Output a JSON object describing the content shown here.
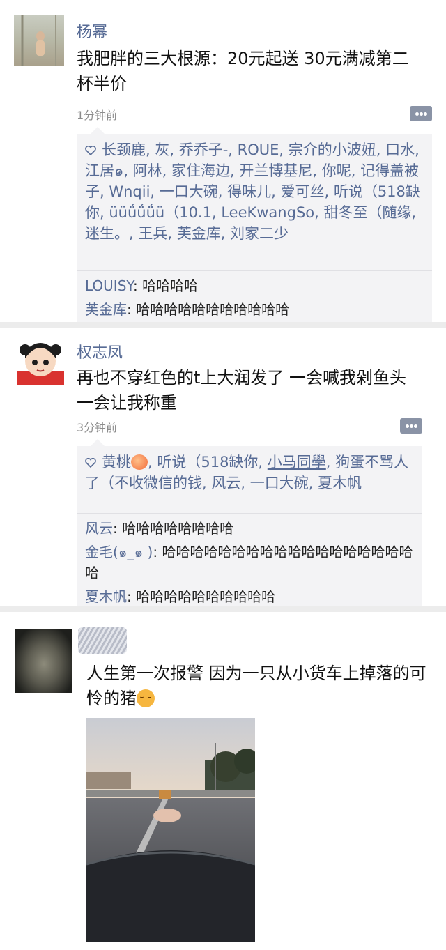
{
  "posts": [
    {
      "name": "杨幂",
      "content": "我肥胖的三大根源：20元起送 30元满减第二杯半价",
      "time": "1分钟前",
      "likes": "长颈鹿, 灰, 乔乔子-, ROUE, 宗介的小波妞, 口水, 江居๑, 阿林, 家住海边, 开兰博基尼, 你呢, 记得盖被子, Wnqii, 一口大碗, 得味儿, 爱可丝, 听说（518缺你, üüǘǘǘü（10.1, LeeKwangSo, 甜冬至（随缘, 迷生。, 王兵, 芙金库, 刘家二少",
      "comments": [
        {
          "who": "LOUISY",
          "sep": ": ",
          "text": "哈哈哈哈"
        },
        {
          "who": "芙金库",
          "sep": ": ",
          "text": "哈哈哈哈哈哈哈哈哈哈哈"
        }
      ]
    },
    {
      "name": "权志凤",
      "content": "再也不穿红色的t上大润发了 一会喊我剁鱼头 一会让我称重",
      "time": "3分钟前",
      "likes_a": "黄桃",
      "likes_b": ", 听说（518缺你, ",
      "likes_link": "小马同學",
      "likes_c": ", 狗蛋不骂人了（不收微信的钱, 风云, 一口大碗, 夏木帆",
      "comments": [
        {
          "who": "风云",
          "sep": ": ",
          "text": "哈哈哈哈哈哈哈哈"
        },
        {
          "who": "金毛(๑_๑ )",
          "sep": ": ",
          "text": "哈哈哈哈哈哈哈哈哈哈哈哈哈哈哈哈哈哈哈"
        },
        {
          "who": "夏木帆",
          "sep": ": ",
          "text": "哈哈哈哈哈哈哈哈哈哈"
        }
      ]
    },
    {
      "content": "人生第一次报警 因为一只从小货车上掉落的可怜的猪"
    }
  ],
  "colors": {
    "name": "#576b95",
    "like_bg": "#f3f3f5",
    "time": "#8c8c8c"
  }
}
